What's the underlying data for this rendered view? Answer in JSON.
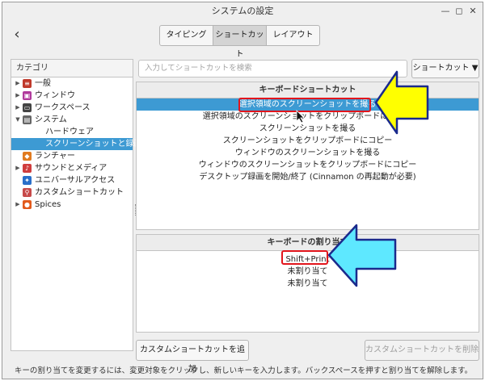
{
  "window": {
    "title": "システムの設定"
  },
  "tabs": [
    {
      "label": "タイピング"
    },
    {
      "label": "ショートカット",
      "active": true
    },
    {
      "label": "レイアウト"
    }
  ],
  "sidebar": {
    "header": "カテゴリ",
    "items": [
      {
        "label": "一般",
        "expand": "collapsed",
        "icon": "general-icon",
        "color": "#c0392b",
        "glyph": "≡"
      },
      {
        "label": "ウィンドウ",
        "expand": "collapsed",
        "icon": "window-icon",
        "color": "#b03a9c",
        "glyph": "▣"
      },
      {
        "label": "ワークスペース",
        "expand": "collapsed",
        "icon": "workspace-icon",
        "color": "#444444",
        "glyph": "▭"
      },
      {
        "label": "システム",
        "expand": "expanded",
        "icon": "system-icon",
        "color": "#666666",
        "glyph": "▤"
      },
      {
        "label": "ハードウェア",
        "level": 2
      },
      {
        "label": "スクリーンショットと録画",
        "level": 2,
        "selected": true
      },
      {
        "label": "ランチャー",
        "icon": "launcher-icon",
        "color": "#e07b20",
        "glyph": "◆"
      },
      {
        "label": "サウンドとメディア",
        "expand": "collapsed",
        "icon": "sound-icon",
        "color": "#d03d3d",
        "glyph": "♪"
      },
      {
        "label": "ユニバーサルアクセス",
        "icon": "accessibility-icon",
        "color": "#2a6fc9",
        "glyph": "✦"
      },
      {
        "label": "カスタムショートカット",
        "icon": "custom-shortcut-icon",
        "color": "#c74a4a",
        "glyph": "⚲"
      },
      {
        "label": "Spices",
        "expand": "collapsed",
        "icon": "spices-icon",
        "color": "#e25a1c",
        "glyph": "●"
      }
    ]
  },
  "search": {
    "placeholder": "入力してショートカットを検索"
  },
  "filter": {
    "label": "ショートカット ▼"
  },
  "shortcuts": {
    "header": "キーボードショートカット",
    "items": [
      {
        "label": "選択領域のスクリーンショットを撮る",
        "selected": true
      },
      {
        "label": "選択領域のスクリーンショットをクリップボードにコピー"
      },
      {
        "label": "スクリーンショットを撮る"
      },
      {
        "label": "スクリーンショットをクリップボードにコピー"
      },
      {
        "label": "ウィンドウのスクリーンショットを撮る"
      },
      {
        "label": "ウィンドウのスクリーンショットをクリップボードにコピー"
      },
      {
        "label": "デスクトップ録画を開始/終了 (Cinnamon の再起動が必要)"
      }
    ]
  },
  "bindings": {
    "header": "キーボードの割り当て",
    "items": [
      {
        "label": "Shift+Print"
      },
      {
        "label": "未割り当て"
      },
      {
        "label": "未割り当て"
      }
    ]
  },
  "buttons": {
    "add_custom": "カスタムショートカットを追加",
    "remove_custom": "カスタムショートカットを削除"
  },
  "status": "キーの割り当てを変更するには、変更対象をクリックし、新しいキーを入力します。バックスペースを押すと割り当てを解除します。",
  "colors": {
    "selection": "#3d9ad3",
    "highlight_box": "#e2151c",
    "arrow_yellow": "#ffff00",
    "arrow_cyan": "#5ee8ff",
    "arrow_outline": "#1a2a8c"
  }
}
